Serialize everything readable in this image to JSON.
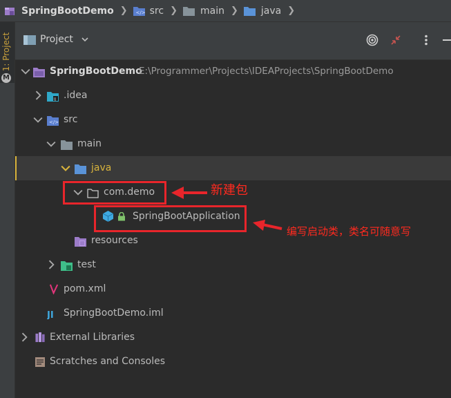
{
  "breadcrumb": {
    "project": "SpringBootDemo",
    "items": [
      "src",
      "main",
      "java"
    ]
  },
  "stripe": {
    "project_label": "1: Project"
  },
  "tool_window": {
    "view_selector": "Project"
  },
  "tree": {
    "root_name": "SpringBootDemo",
    "root_path": "E:\\Programmer\\Projects\\IDEAProjects\\SpringBootDemo",
    "idea": ".idea",
    "src": "src",
    "main": "main",
    "java": "java",
    "package": "com.demo",
    "app_class": "SpringBootApplication",
    "resources": "resources",
    "test": "test",
    "pom": "pom.xml",
    "iml": "SpringBootDemo.iml",
    "external_libraries": "External Libraries",
    "scratches": "Scratches and Consoles"
  },
  "annotations": {
    "new_package": "新建包",
    "write_startup": "编写启动类，类名可随意写"
  },
  "colors": {
    "background": "#2b2b2b",
    "panel": "#3c3f41",
    "folder": "#87939a",
    "source_folder": "#5a7fcf",
    "annotation": "#e8252b",
    "selection_marker": "#d9b43c"
  }
}
